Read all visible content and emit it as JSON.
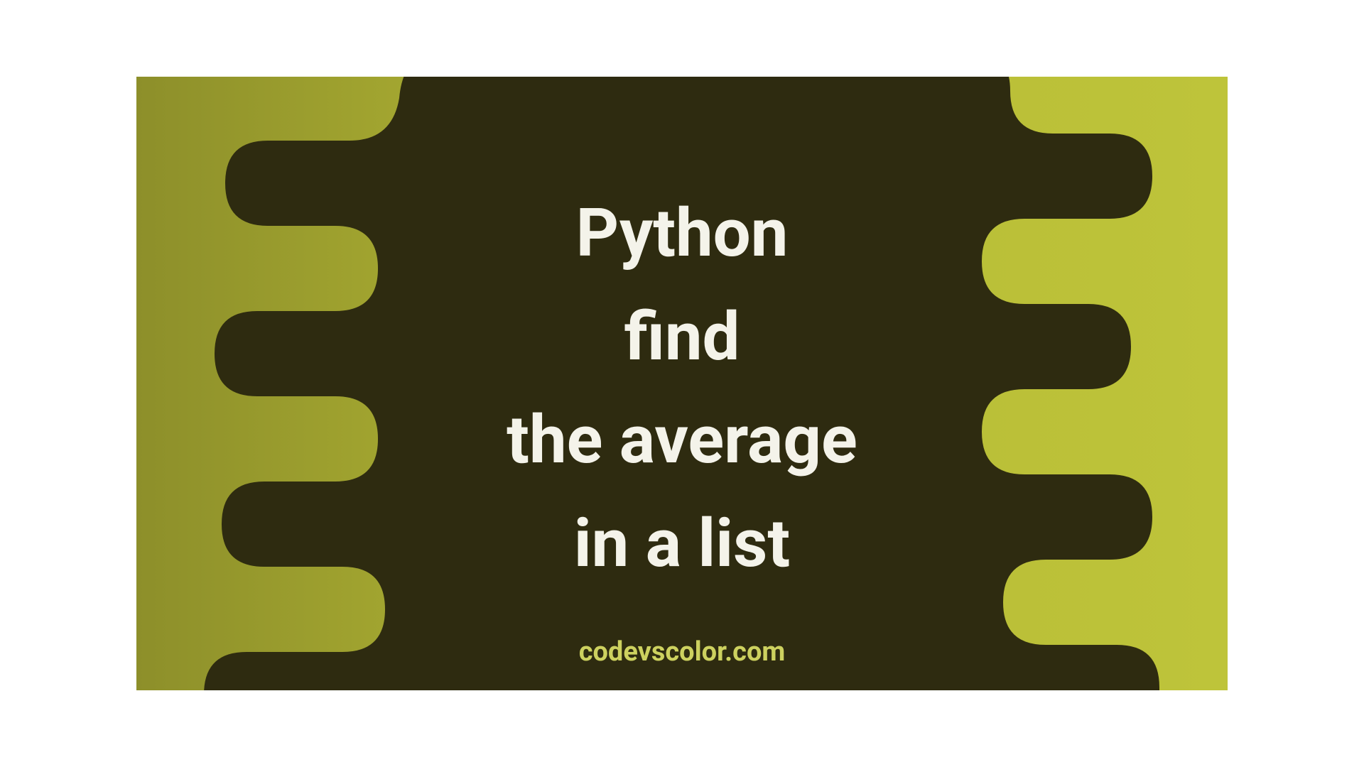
{
  "title": {
    "line1": "Python",
    "line2": "find",
    "line3": "the average",
    "line4": "in a list"
  },
  "watermark": "codevscolor.com",
  "colors": {
    "bg_left": "#8d8f2a",
    "bg_right": "#bec43a",
    "blob": "#2e2b10",
    "title_text": "#f4f3ea",
    "watermark_text": "#cdd15f"
  }
}
